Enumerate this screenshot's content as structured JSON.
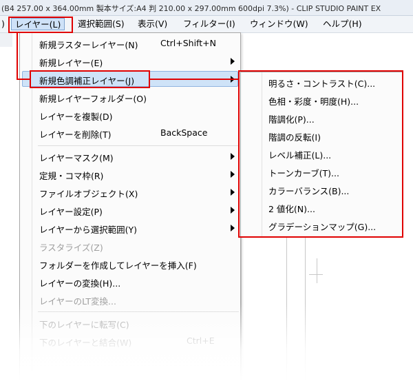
{
  "titlebar": {
    "text": "(B4 257.00 x 364.00mm 製本サイズ:A4 判 210.00 x 297.00mm 600dpi 7.3%) - CLIP STUDIO PAINT EX"
  },
  "menubar": {
    "items": [
      {
        "label": ")"
      },
      {
        "label": "レイヤー(L)"
      },
      {
        "label": "選択範囲(S)"
      },
      {
        "label": "表示(V)"
      },
      {
        "label": "フィルター(I)"
      },
      {
        "label": "ウィンドウ(W)"
      },
      {
        "label": "ヘルプ(H)"
      }
    ]
  },
  "layer_menu": {
    "items": [
      {
        "label": "新規ラスターレイヤー(N)",
        "shortcut": "Ctrl+Shift+N"
      },
      {
        "label": "新規レイヤー(E)"
      },
      {
        "label": "新規色調補正レイヤー(J)"
      },
      {
        "label": "新規レイヤーフォルダー(O)"
      },
      {
        "label": "レイヤーを複製(D)"
      },
      {
        "label": "レイヤーを削除(T)",
        "shortcut": "BackSpace"
      },
      {
        "label": "レイヤーマスク(M)"
      },
      {
        "label": "定規・コマ枠(R)"
      },
      {
        "label": "ファイルオブジェクト(X)"
      },
      {
        "label": "レイヤー設定(P)"
      },
      {
        "label": "レイヤーから選択範囲(Y)"
      },
      {
        "label": "ラスタライズ(Z)"
      },
      {
        "label": "フォルダーを作成してレイヤーを挿入(F)"
      },
      {
        "label": "レイヤーの変換(H)..."
      },
      {
        "label": "レイヤーのLT変換..."
      },
      {
        "label": "下のレイヤーに転写(C)"
      },
      {
        "label": "下のレイヤーと結合(W)",
        "shortcut": "Ctrl+E"
      }
    ]
  },
  "correction_submenu": {
    "items": [
      {
        "label": "明るさ・コントラスト(C)..."
      },
      {
        "label": "色相・彩度・明度(H)..."
      },
      {
        "label": "階調化(P)..."
      },
      {
        "label": "階調の反転(I)"
      },
      {
        "label": "レベル補正(L)..."
      },
      {
        "label": "トーンカーブ(T)..."
      },
      {
        "label": "カラーバランス(B)..."
      },
      {
        "label": "2 値化(N)..."
      },
      {
        "label": "グラデーションマップ(G)..."
      }
    ]
  },
  "colors": {
    "highlight": "#cfe3f8",
    "annotation": "#e00000",
    "disabled_text": "#9e9e9e"
  }
}
